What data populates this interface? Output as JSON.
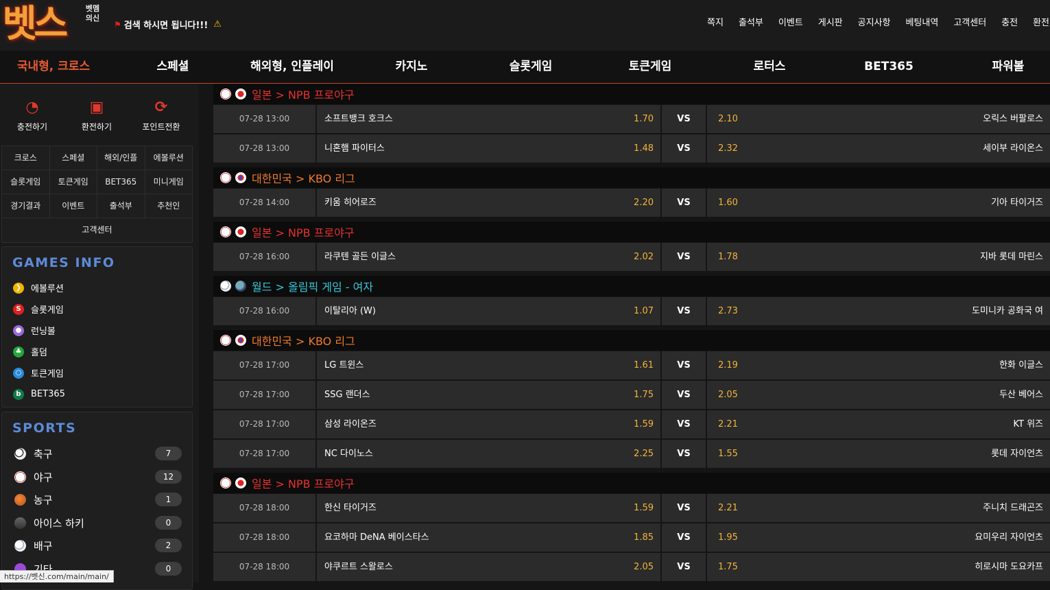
{
  "header": {
    "logo_text": "벳스",
    "logo_sub": "벳멤의신",
    "notice": "검색 하시면 됩니다!!!",
    "topmenu": [
      "쪽지",
      "출석부",
      "이벤트",
      "게시판",
      "공지사항",
      "베팅내역",
      "고객센터",
      "충전",
      "환전"
    ]
  },
  "nav": {
    "items": [
      "국내형, 크로스",
      "스페셜",
      "해외형, 인플레이",
      "카지노",
      "슬롯게임",
      "토큰게임",
      "로터스",
      "BET365",
      "파워볼"
    ],
    "active_index": 0
  },
  "sidebar": {
    "quick": [
      {
        "label": "충전하기",
        "icon": "piggy-bank-icon"
      },
      {
        "label": "환전하기",
        "icon": "cash-register-icon"
      },
      {
        "label": "포인트전환",
        "icon": "refresh-icon"
      }
    ],
    "grid": [
      [
        "크로스",
        "스페셜",
        "해외/인플",
        "에볼루션"
      ],
      [
        "슬롯게임",
        "토큰게임",
        "BET365",
        "미니게임"
      ],
      [
        "경기결과",
        "이벤트",
        "출석부",
        "추천인"
      ],
      [
        "고객센터"
      ]
    ],
    "games_info": {
      "title": "GAMES INFO",
      "items": [
        {
          "label": "에볼루션",
          "icon": "evolution-icon",
          "color": "#f0b400"
        },
        {
          "label": "슬롯게임",
          "icon": "slot-icon",
          "color": "#e02020"
        },
        {
          "label": "런닝볼",
          "icon": "running-ball-icon",
          "color": "#9c6ad8"
        },
        {
          "label": "홀덤",
          "icon": "holdem-icon",
          "color": "#22a83a"
        },
        {
          "label": "토큰게임",
          "icon": "token-icon",
          "color": "#2a8ad8"
        },
        {
          "label": "BET365",
          "icon": "bet365-icon",
          "color": "#127a4a"
        }
      ]
    },
    "sports": {
      "title": "SPORTS",
      "items": [
        {
          "label": "축구",
          "count": "7",
          "icon": "soccer-icon"
        },
        {
          "label": "야구",
          "count": "12",
          "icon": "baseball-icon"
        },
        {
          "label": "농구",
          "count": "1",
          "icon": "basketball-icon"
        },
        {
          "label": "아이스 하키",
          "count": "0",
          "icon": "hockey-puck-icon"
        },
        {
          "label": "배구",
          "count": "2",
          "icon": "volleyball-icon"
        },
        {
          "label": "기타",
          "count": "0",
          "icon": "etc-icon"
        }
      ]
    }
  },
  "status_url": "https://벳신.com/main/main/",
  "leagues": [
    {
      "name": "일본 > NPB 프로야구",
      "color": "#e83030",
      "flag": "japan-flag-icon",
      "sport": "baseball-icon",
      "games": [
        {
          "time": "07-28 13:00",
          "home": "소프트뱅크 호크스",
          "home_odds": "1.70",
          "vs": "VS",
          "away_odds": "2.10",
          "away": "오릭스 버팔로스"
        },
        {
          "time": "07-28 13:00",
          "home": "니혼햄 파이터스",
          "home_odds": "1.48",
          "vs": "VS",
          "away_odds": "2.32",
          "away": "세이부 라이온스"
        }
      ]
    },
    {
      "name": "대한민국 > KBO 리그",
      "color": "#f07a2a",
      "flag": "korea-flag-icon",
      "sport": "baseball-icon",
      "games": [
        {
          "time": "07-28 14:00",
          "home": "키움 히어로즈",
          "home_odds": "2.20",
          "vs": "VS",
          "away_odds": "1.60",
          "away": "기아 타이거즈"
        }
      ]
    },
    {
      "name": "일본 > NPB 프로야구",
      "color": "#e83030",
      "flag": "japan-flag-icon",
      "sport": "baseball-icon",
      "games": [
        {
          "time": "07-28 16:00",
          "home": "라쿠텐 골든 이글스",
          "home_odds": "2.02",
          "vs": "VS",
          "away_odds": "1.78",
          "away": "지바 롯데 마린스"
        }
      ]
    },
    {
      "name": "월드 > 올림픽 게임 - 여자",
      "color": "#39c6d8",
      "flag": "world-flag-icon",
      "sport": "volleyball-icon",
      "games": [
        {
          "time": "07-28 16:00",
          "home": "이탈리아 (W)",
          "home_odds": "1.07",
          "vs": "VS",
          "away_odds": "2.73",
          "away": "도미니카 공화국 여"
        }
      ]
    },
    {
      "name": "대한민국 > KBO 리그",
      "color": "#f07a2a",
      "flag": "korea-flag-icon",
      "sport": "baseball-icon",
      "games": [
        {
          "time": "07-28 17:00",
          "home": "LG 트윈스",
          "home_odds": "1.61",
          "vs": "VS",
          "away_odds": "2.19",
          "away": "한화 이글스"
        },
        {
          "time": "07-28 17:00",
          "home": "SSG 랜더스",
          "home_odds": "1.75",
          "vs": "VS",
          "away_odds": "2.05",
          "away": "두산 베어스"
        },
        {
          "time": "07-28 17:00",
          "home": "삼성 라이온즈",
          "home_odds": "1.59",
          "vs": "VS",
          "away_odds": "2.21",
          "away": "KT 위즈"
        },
        {
          "time": "07-28 17:00",
          "home": "NC 다이노스",
          "home_odds": "2.25",
          "vs": "VS",
          "away_odds": "1.55",
          "away": "롯데 자이언츠"
        }
      ]
    },
    {
      "name": "일본 > NPB 프로야구",
      "color": "#e83030",
      "flag": "japan-flag-icon",
      "sport": "baseball-icon",
      "games": [
        {
          "time": "07-28 18:00",
          "home": "한신 타이거즈",
          "home_odds": "1.59",
          "vs": "VS",
          "away_odds": "2.21",
          "away": "주니치 드래곤즈"
        },
        {
          "time": "07-28 18:00",
          "home": "요코하마 DeNA 베이스타스",
          "home_odds": "1.85",
          "vs": "VS",
          "away_odds": "1.95",
          "away": "요미우리 자이언츠"
        },
        {
          "time": "07-28 18:00",
          "home": "야쿠르트 스왈로스",
          "home_odds": "2.05",
          "vs": "VS",
          "away_odds": "1.75",
          "away": "히로시마 도요카프"
        }
      ]
    }
  ]
}
